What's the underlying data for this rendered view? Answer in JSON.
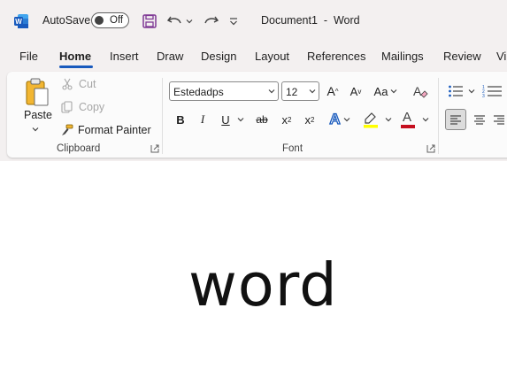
{
  "titlebar": {
    "autosave_label": "AutoSave",
    "autosave_state": "Off",
    "document_title": "Document1  -  Word"
  },
  "tabs": [
    {
      "label": "File"
    },
    {
      "label": "Home",
      "active": true
    },
    {
      "label": "Insert"
    },
    {
      "label": "Draw"
    },
    {
      "label": "Design"
    },
    {
      "label": "Layout"
    },
    {
      "label": "References"
    },
    {
      "label": "Mailings"
    },
    {
      "label": "Review"
    },
    {
      "label": "Vi"
    }
  ],
  "clipboard": {
    "paste_label": "Paste",
    "cut_label": "Cut",
    "copy_label": "Copy",
    "format_painter_label": "Format Painter",
    "group_label": "Clipboard"
  },
  "font": {
    "font_name": "Estedadps",
    "font_size": "12",
    "group_label": "Font",
    "grow_label": "A",
    "shrink_label": "A",
    "case_label": "Aa",
    "bold_label": "B",
    "italic_label": "I",
    "underline_label": "U",
    "strike_label": "ab",
    "subscript_label": "x",
    "subscript_sub": "2",
    "superscript_label": "x",
    "superscript_sup": "2",
    "text_effects_label": "A",
    "font_color_label": "A",
    "highlight_color": "#ffff00",
    "font_color": "#c50f1f"
  },
  "document": {
    "text": "word"
  },
  "colors": {
    "word_blue": "#185abd",
    "chrome_bg": "#f3f0f0"
  }
}
